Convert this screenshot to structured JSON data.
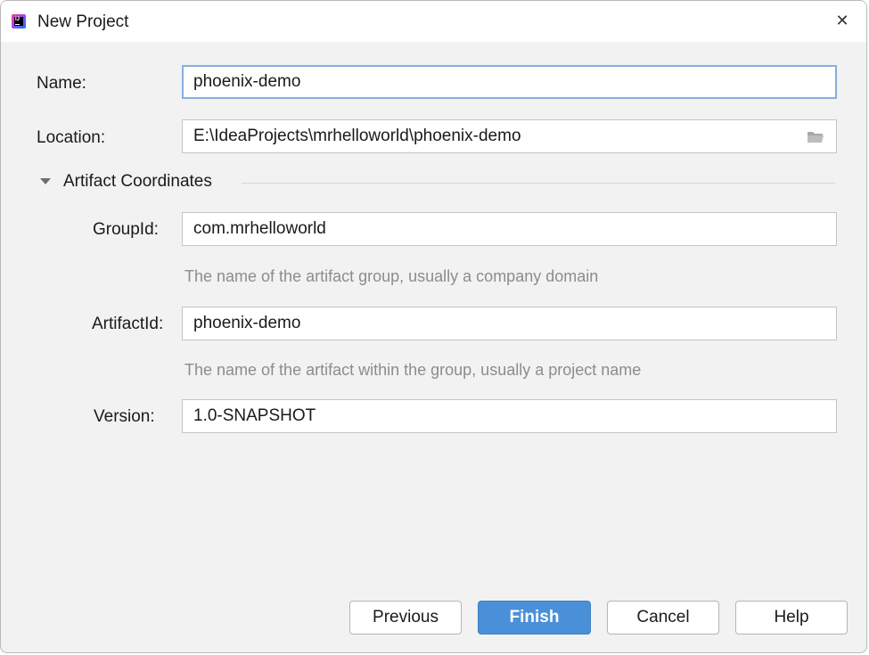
{
  "window": {
    "title": "New Project",
    "close_glyph": "✕"
  },
  "form": {
    "name": {
      "label": "Name:",
      "value": "phoenix-demo"
    },
    "location": {
      "label": "Location:",
      "value": "E:\\IdeaProjects\\mrhelloworld\\phoenix-demo",
      "icon": "folder-icon"
    }
  },
  "artifact": {
    "section_title": "Artifact Coordinates",
    "expanded": true,
    "group_id": {
      "label": "GroupId:",
      "value": "com.mrhelloworld",
      "hint": "The name of the artifact group, usually a company domain"
    },
    "artifact_id": {
      "label": "ArtifactId:",
      "value": "phoenix-demo",
      "hint": "The name of the artifact within the group, usually a project name"
    },
    "version": {
      "label": "Version:",
      "value": "1.0-SNAPSHOT"
    }
  },
  "buttons": {
    "previous": "Previous",
    "finish": "Finish",
    "cancel": "Cancel",
    "help": "Help"
  },
  "colors": {
    "primary_button": "#4a90d9",
    "focus_border": "#87aedc",
    "dialog_background": "#f2f2f2",
    "hint_text": "#8c8c8c"
  }
}
